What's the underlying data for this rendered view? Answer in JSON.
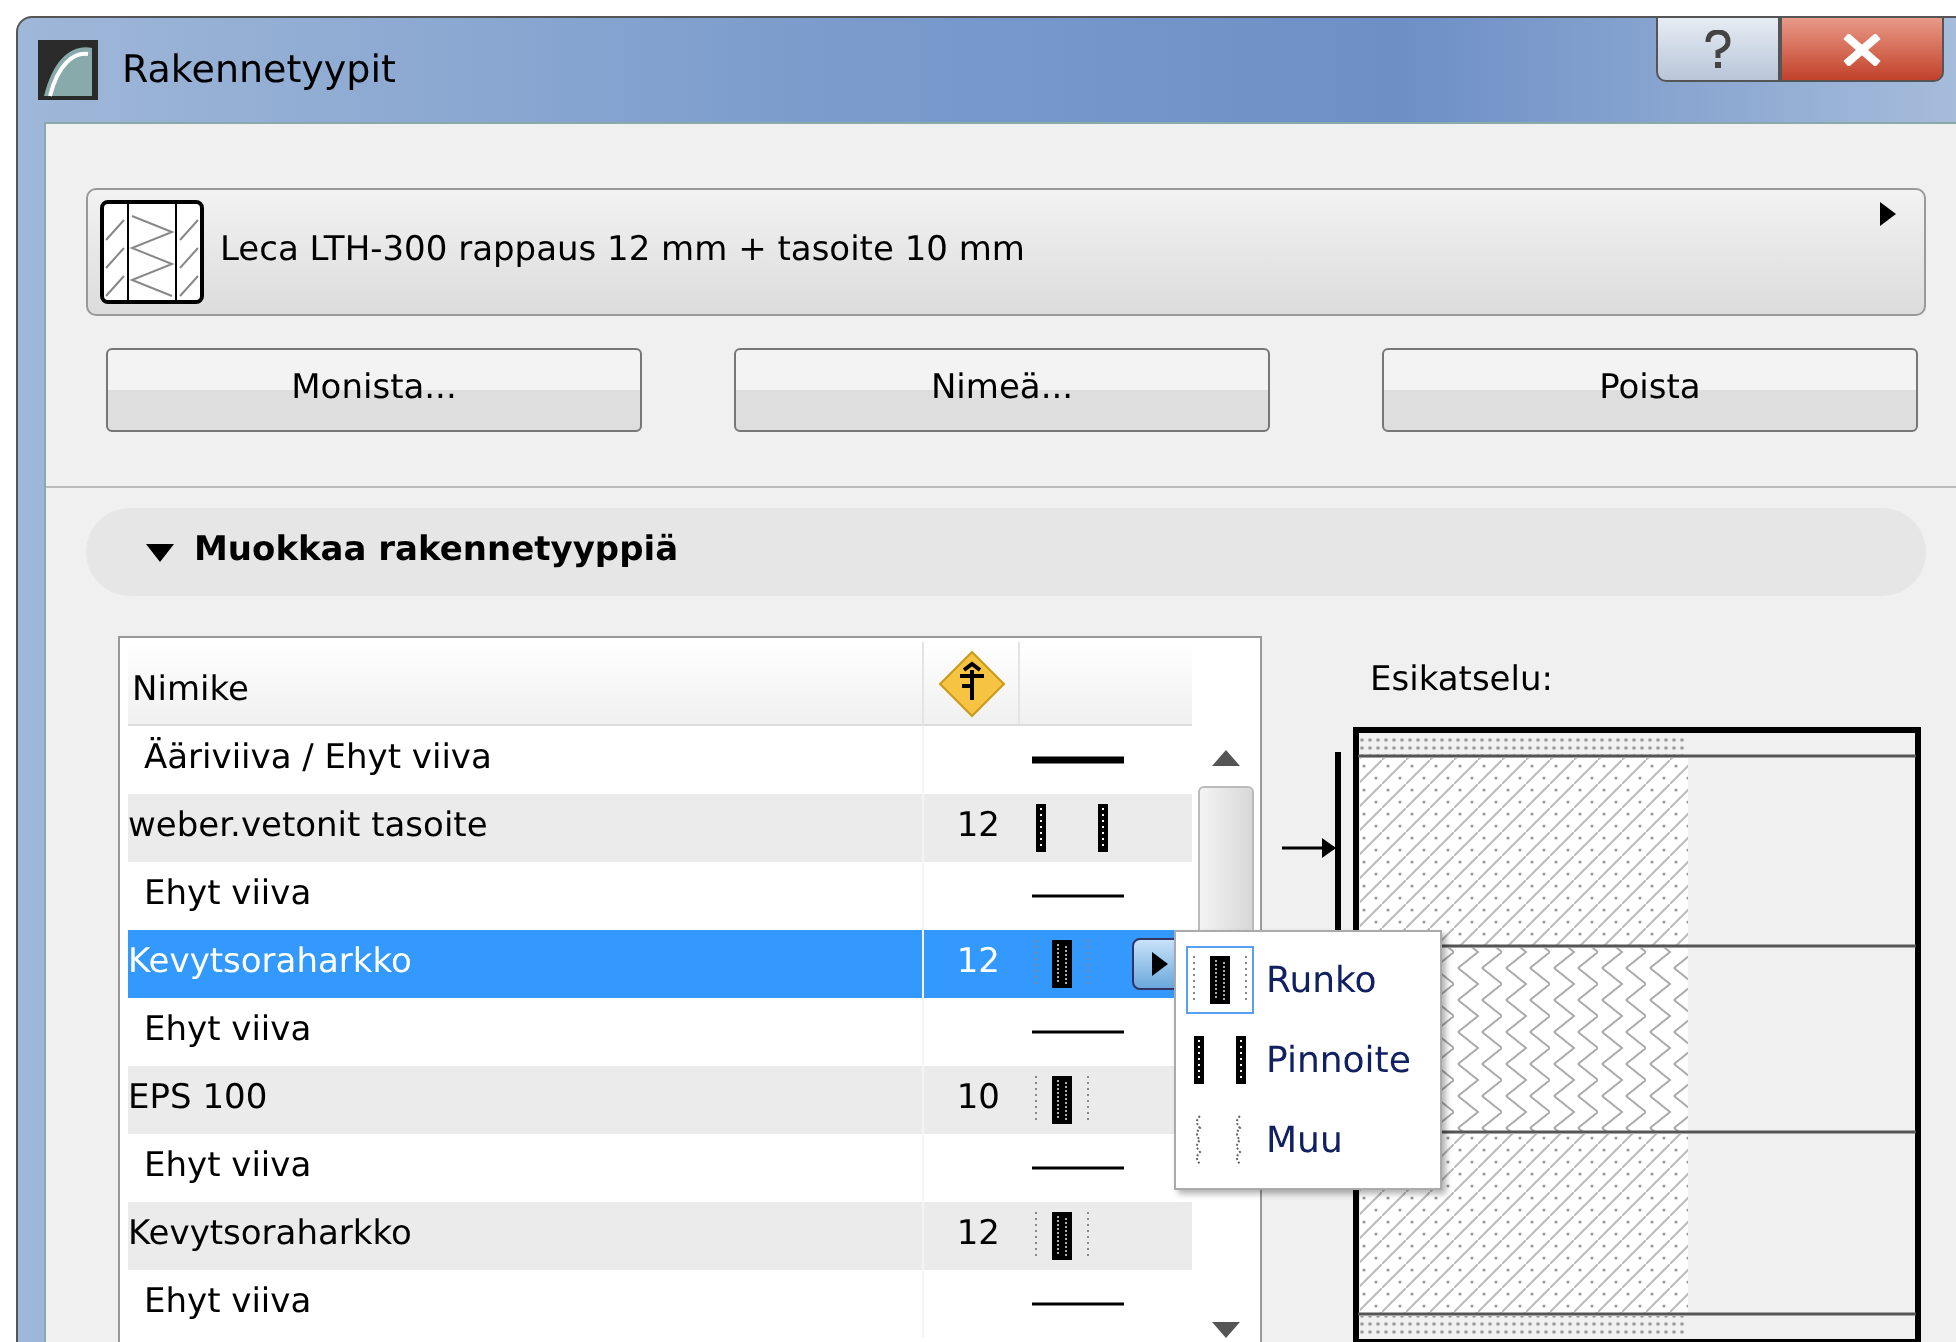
{
  "window": {
    "title": "Rakennetyypit"
  },
  "composite": {
    "name": "Leca LTH-300 rappaus 12 mm + tasoite 10 mm"
  },
  "buttons": [
    "Monista...",
    "Nimeä...",
    "Poista"
  ],
  "section": {
    "title": "Muokkaa rakennetyyppiä",
    "expanded": true
  },
  "table": {
    "columns": [
      "Nimike"
    ],
    "rows": [
      {
        "kind": "line",
        "name": "Ääriviiva / Ehyt viiva",
        "bold": true,
        "selected": false
      },
      {
        "kind": "pinnoite",
        "name": "weber.vetonit tasoite",
        "thickness": "12",
        "selected": false
      },
      {
        "kind": "line",
        "name": "Ehyt viiva",
        "bold": false,
        "selected": false
      },
      {
        "kind": "runko",
        "name": "Kevytsoraharkko",
        "thickness": "12",
        "selected": true
      },
      {
        "kind": "line",
        "name": "Ehyt viiva",
        "bold": false,
        "selected": false
      },
      {
        "kind": "runko",
        "name": "EPS 100",
        "thickness": "10",
        "selected": false
      },
      {
        "kind": "line",
        "name": "Ehyt viiva",
        "bold": false,
        "selected": false
      },
      {
        "kind": "runko",
        "name": "Kevytsoraharkko",
        "thickness": "12",
        "selected": false
      },
      {
        "kind": "line",
        "name": "Ehyt viiva",
        "bold": false,
        "selected": false
      }
    ]
  },
  "layer_menu": {
    "items": [
      {
        "label": "Runko",
        "kind": "runko",
        "selected": true
      },
      {
        "label": "Pinnoite",
        "kind": "pinnoite",
        "selected": false
      },
      {
        "label": "Muu",
        "kind": "muu",
        "selected": false
      }
    ]
  },
  "preview": {
    "label": "Esikatselu:"
  }
}
